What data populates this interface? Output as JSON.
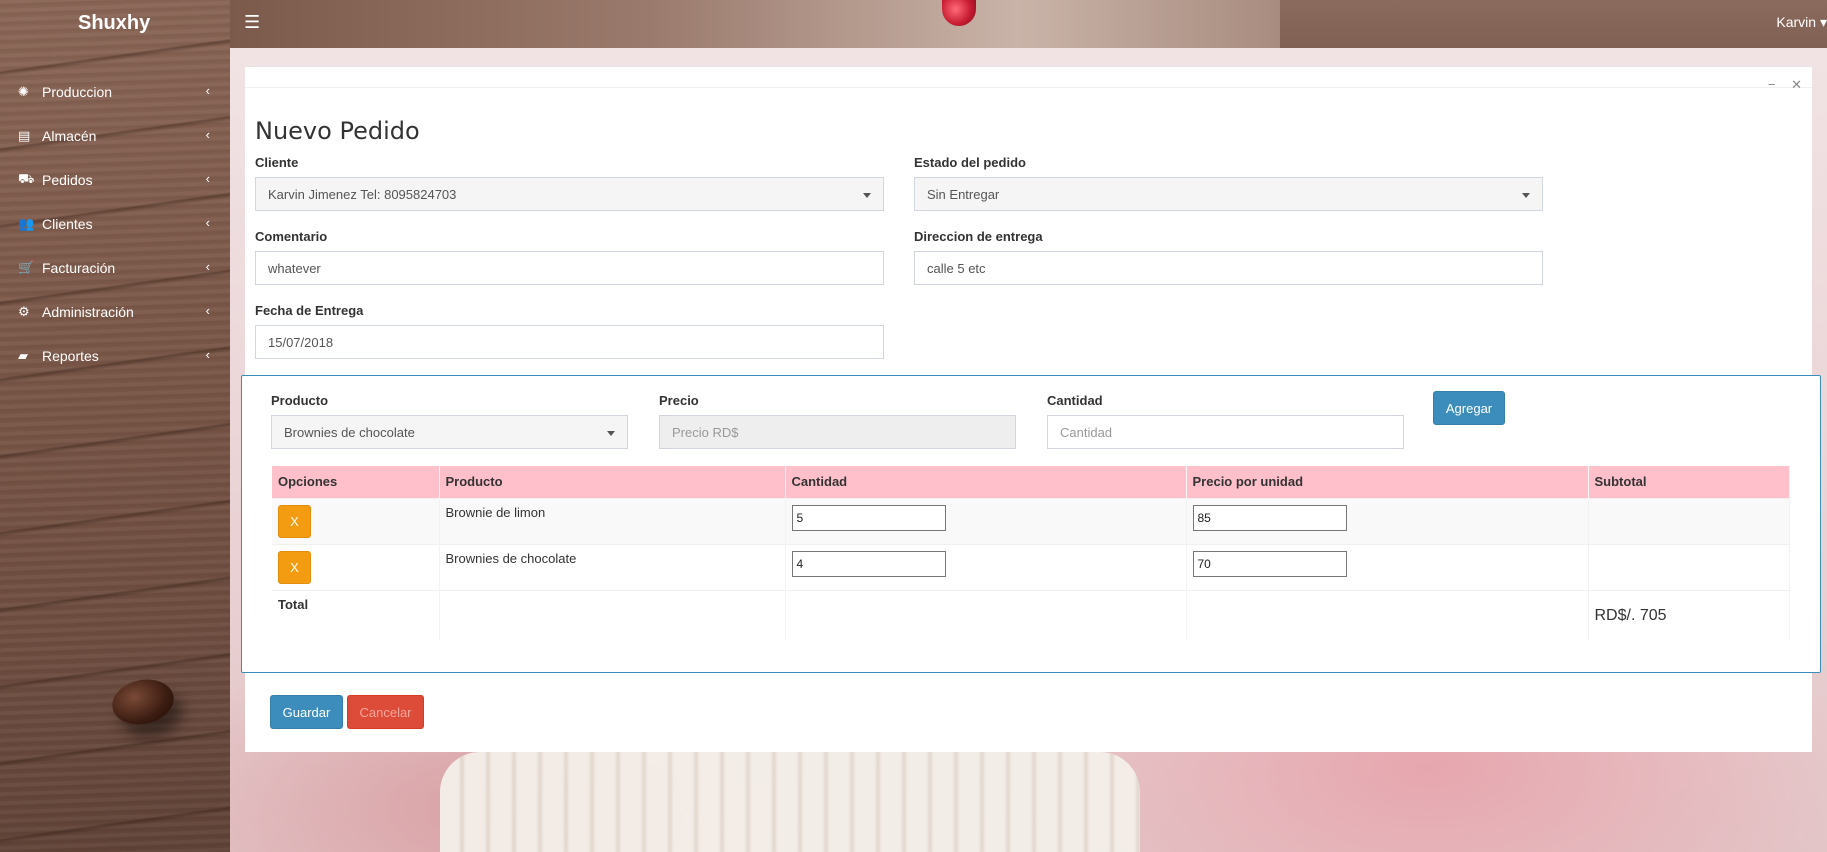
{
  "app": {
    "brand": "Shuxhy",
    "user": "Karvin"
  },
  "sidebar": {
    "items": [
      {
        "label": "Produccion",
        "icon": "spinner-icon"
      },
      {
        "label": "Almacén",
        "icon": "archive-icon"
      },
      {
        "label": "Pedidos",
        "icon": "truck-icon"
      },
      {
        "label": "Clientes",
        "icon": "users-icon"
      },
      {
        "label": "Facturación",
        "icon": "cart-icon"
      },
      {
        "label": "Administración",
        "icon": "gear-icon"
      },
      {
        "label": "Reportes",
        "icon": "folder-icon"
      }
    ]
  },
  "form": {
    "title": "Nuevo Pedido",
    "cliente": {
      "label": "Cliente",
      "value": "Karvin Jimenez Tel: 8095824703"
    },
    "estado": {
      "label": "Estado del pedido",
      "value": "Sin Entregar"
    },
    "comentario": {
      "label": "Comentario",
      "value": "whatever"
    },
    "direccion": {
      "label": "Direccion de entrega",
      "value": "calle 5 etc"
    },
    "fecha": {
      "label": "Fecha de Entrega",
      "value": "15/07/2018"
    }
  },
  "product_entry": {
    "producto": {
      "label": "Producto",
      "value": "Brownies de chocolate"
    },
    "precio": {
      "label": "Precio",
      "placeholder": "Precio RD$"
    },
    "cantidad": {
      "label": "Cantidad",
      "placeholder": "Cantidad"
    },
    "add_label": "Agregar"
  },
  "table": {
    "headers": [
      "Opciones",
      "Producto",
      "Cantidad",
      "Precio por unidad",
      "Subtotal"
    ],
    "rows": [
      {
        "remove": "X",
        "producto": "Brownie de limon",
        "cantidad": "5",
        "precio": "85"
      },
      {
        "remove": "X",
        "producto": "Brownies de chocolate",
        "cantidad": "4",
        "precio": "70"
      }
    ],
    "total_label": "Total",
    "total_value": "RD$/. 705"
  },
  "actions": {
    "save_label": "Guardar",
    "cancel_label": "Cancelar"
  },
  "colors": {
    "primary": "#3c8dbc",
    "danger": "#dd4b39",
    "warning": "#f39c12",
    "table_header": "#ffc0cb"
  }
}
